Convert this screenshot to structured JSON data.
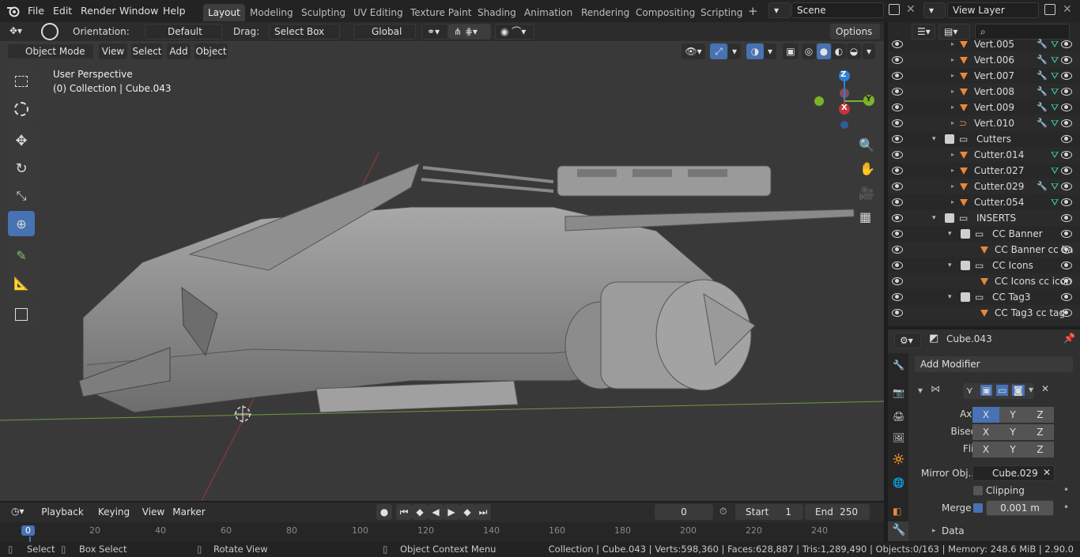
{
  "top_menu": [
    "File",
    "Edit",
    "Render",
    "Window",
    "Help"
  ],
  "workspaces": [
    "Layout",
    "Modeling",
    "Sculpting",
    "UV Editing",
    "Texture Paint",
    "Shading",
    "Animation",
    "Rendering",
    "Compositing",
    "Scripting"
  ],
  "active_workspace": "Layout",
  "scene_name": "Scene",
  "view_layer": "View Layer",
  "tool_header": {
    "orientation_label": "Orientation:",
    "orientation_value": "Default",
    "drag_label": "Drag:",
    "drag_value": "Select Box",
    "transform_space": "Global",
    "options": "Options"
  },
  "viewport_header": {
    "mode": "Object Mode",
    "menus": [
      "View",
      "Select",
      "Add",
      "Object"
    ]
  },
  "viewport_overlay": {
    "perspective": "User Perspective",
    "collection": "(0) Collection | Cube.043"
  },
  "gizmo": {
    "z": "Z",
    "x": "X",
    "y": "Y"
  },
  "outliner": {
    "rows": [
      {
        "name": "Vert.005",
        "type": "mesh"
      },
      {
        "name": "Vert.006",
        "type": "mesh"
      },
      {
        "name": "Vert.007",
        "type": "mesh"
      },
      {
        "name": "Vert.008",
        "type": "mesh"
      },
      {
        "name": "Vert.009",
        "type": "mesh"
      },
      {
        "name": "Vert.010",
        "type": "curve"
      },
      {
        "name": "Cutters",
        "type": "collection"
      },
      {
        "name": "Cutter.014",
        "type": "mesh"
      },
      {
        "name": "Cutter.027",
        "type": "mesh"
      },
      {
        "name": "Cutter.029",
        "type": "mesh"
      },
      {
        "name": "Cutter.054",
        "type": "mesh"
      },
      {
        "name": "INSERTS",
        "type": "collection"
      },
      {
        "name": "CC Banner",
        "type": "collection"
      },
      {
        "name": "CC Banner cc ba",
        "type": "mesh"
      },
      {
        "name": "CC Icons",
        "type": "collection"
      },
      {
        "name": "CC Icons cc icon",
        "type": "mesh"
      },
      {
        "name": "CC Tag3",
        "type": "collection"
      },
      {
        "name": "CC Tag3 cc tag",
        "type": "mesh"
      }
    ]
  },
  "properties": {
    "object_name": "Cube.043",
    "add_modifier": "Add Modifier",
    "axis_label": "Axis",
    "bisect_label": "Bisect",
    "flip_label": "Flip",
    "xyz": [
      "X",
      "Y",
      "Z"
    ],
    "mirror_obj_label": "Mirror Obj...",
    "mirror_obj_value": "Cube.029",
    "clipping_label": "Clipping",
    "merge_label": "Merge",
    "merge_value": "0.001 m",
    "data_label": "Data"
  },
  "timeline": {
    "menus": [
      "Playback",
      "Keying",
      "View",
      "Marker"
    ],
    "current_frame": "0",
    "start_label": "Start",
    "start_value": "1",
    "end_label": "End",
    "end_value": "250",
    "ticks": [
      "0",
      "20",
      "40",
      "60",
      "80",
      "100",
      "120",
      "140",
      "160",
      "180",
      "200",
      "220",
      "240"
    ]
  },
  "status_bar": {
    "select": "Select",
    "box_select": "Box Select",
    "rotate_view": "Rotate View",
    "context_menu": "Object Context Menu",
    "stats": "Collection | Cube.043 | Verts:598,360 | Faces:628,887 | Tris:1,289,490 | Objects:0/163 | Memory: 248.6 MiB | 2.90.0"
  },
  "colors": {
    "accent": "#4772b3",
    "x_axis": "#c8323c",
    "y_axis": "#7ab32a",
    "z_axis": "#2e7fd6",
    "mesh_icon": "#e8873a",
    "modifier_icon": "#5ea7d8",
    "vertex_group_icon": "#3fc9a0"
  }
}
